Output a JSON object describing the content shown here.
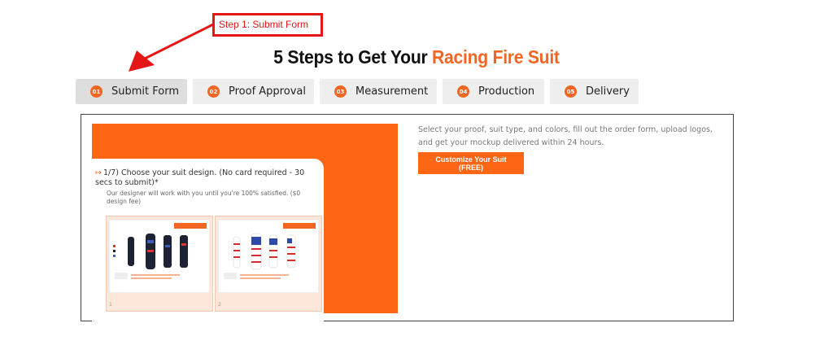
{
  "annotation": {
    "label": "Step 1: Submit Form"
  },
  "title": {
    "prefix": "5 Steps to Get Your ",
    "accent": "Racing Fire Suit"
  },
  "steps": [
    {
      "num": "01",
      "label": "Submit Form"
    },
    {
      "num": "02",
      "label": "Proof Approval"
    },
    {
      "num": "03",
      "label": "Measurement"
    },
    {
      "num": "04",
      "label": "Production"
    },
    {
      "num": "05",
      "label": "Delivery"
    }
  ],
  "form": {
    "arrow": "↦",
    "question": "1/7) Choose your suit design. (No card required - 30 secs to submit)*",
    "subtext": "Our designer will work with you until you're 100% satisfied. ($0 design fee)",
    "options": [
      {
        "num": "1"
      },
      {
        "num": "2"
      }
    ]
  },
  "panel": {
    "description": "Select your proof, suit type, and colors, fill out the order form, upload logos, and get your mockup delivered within 24 hours.",
    "cta_label": "Customize Your Suit (FREE)"
  },
  "colors": {
    "accent": "#f26522",
    "annotation": "#e51616",
    "cta": "#fd6614"
  }
}
